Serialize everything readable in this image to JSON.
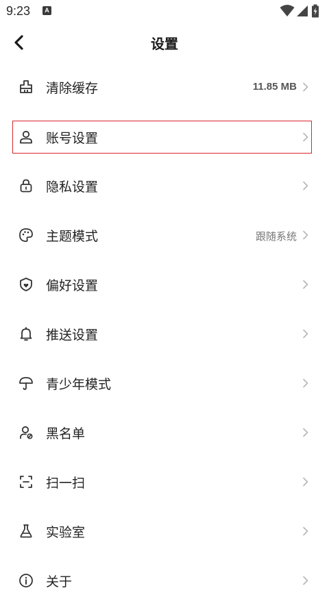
{
  "status_bar": {
    "time": "9:23",
    "notification_badge": "A",
    "icons": [
      "wifi-icon",
      "cell-signal-icon",
      "battery-charging-icon"
    ]
  },
  "header": {
    "title": "设置",
    "back_icon": "chevron-left-icon"
  },
  "settings": {
    "items": [
      {
        "label": "清除缓存",
        "value": "11.85 MB",
        "icon": "broom-icon"
      },
      {
        "label": "账号设置",
        "value": "",
        "icon": "user-icon"
      },
      {
        "label": "隐私设置",
        "value": "",
        "icon": "lock-icon"
      },
      {
        "label": "主题模式",
        "value": "跟随系统",
        "icon": "palette-icon"
      },
      {
        "label": "偏好设置",
        "value": "",
        "icon": "shield-heart-icon"
      },
      {
        "label": "推送设置",
        "value": "",
        "icon": "bell-icon"
      },
      {
        "label": "青少年模式",
        "value": "",
        "icon": "umbrella-icon"
      },
      {
        "label": "黑名单",
        "value": "",
        "icon": "user-block-icon"
      },
      {
        "label": "扫一扫",
        "value": "",
        "icon": "scan-icon"
      },
      {
        "label": "实验室",
        "value": "",
        "icon": "flask-icon"
      },
      {
        "label": "关于",
        "value": "",
        "icon": "info-icon"
      }
    ]
  },
  "colors": {
    "highlight_border": "#d9262b",
    "text_primary": "#222222",
    "text_secondary": "#777777",
    "chevron": "#b5b5b5"
  }
}
